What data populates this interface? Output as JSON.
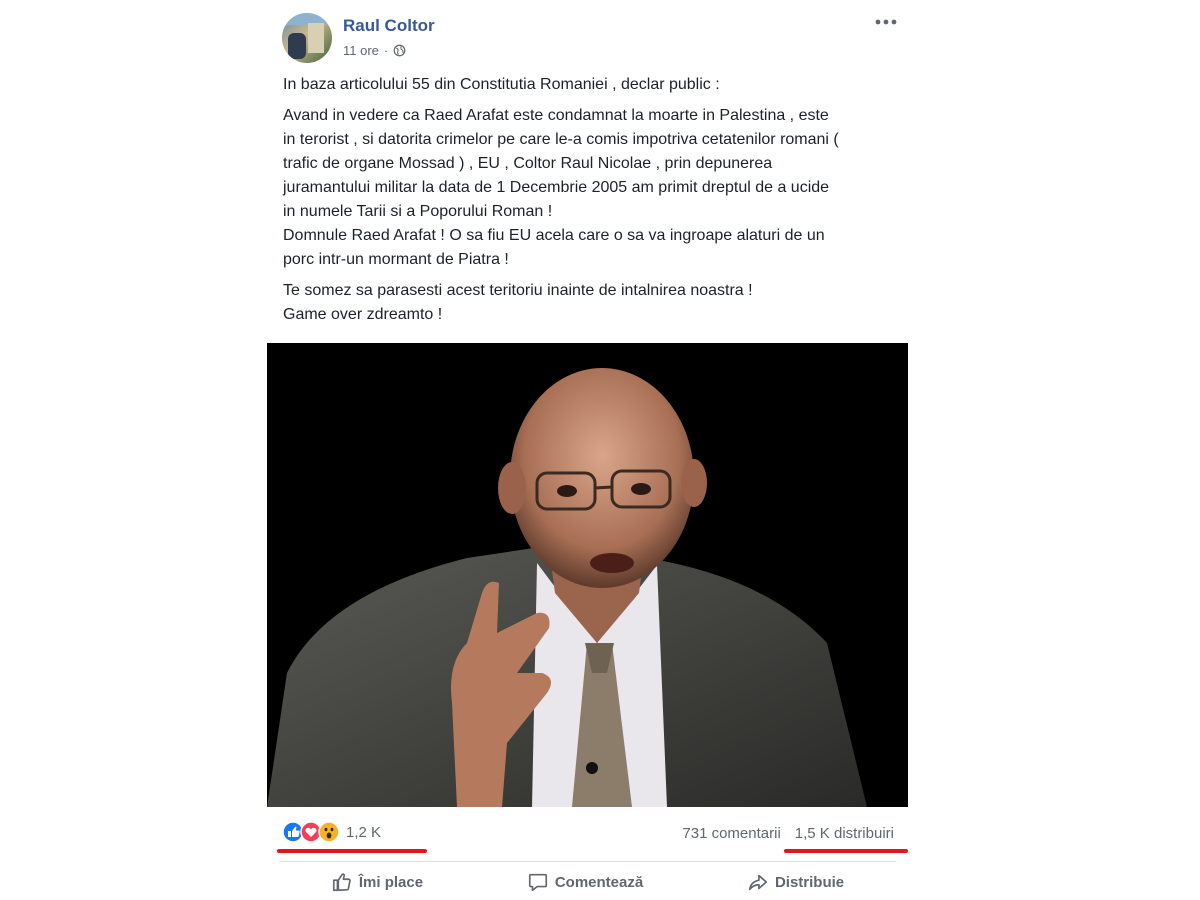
{
  "post": {
    "author": "Raul Coltor",
    "time": "11 ore",
    "privacy_icon": "globe-icon",
    "paragraphs": [
      {
        "lines": [
          "In baza articolului 55 din Constitutia Romaniei , declar public :"
        ]
      },
      {
        "lines": [
          "Avand in vedere ca Raed Arafat este condamnat la moarte in Palestina , este",
          "in terorist , si datorita crimelor pe care le-a comis impotriva cetatenilor romani (",
          "trafic de organe Mossad ) , EU , Coltor Raul Nicolae , prin depunerea",
          "juramantului militar la data de 1 Decembrie 2005 am primit dreptul de a ucide",
          "in numele Tarii si a Poporului Roman !",
          "Domnule Raed Arafat ! O sa fiu EU acela care o sa va ingroape alaturi de un",
          "porc intr-un mormant de Piatra !"
        ]
      },
      {
        "lines": [
          "Te somez sa parasesti acest teritoriu inainte de intalnirea noastra !",
          "Game over zdreamto !"
        ]
      }
    ]
  },
  "stats": {
    "reactions_count": "1,2 K",
    "comments": "731 comentarii",
    "shares": "1,5 K distribuiri",
    "reaction_icons": [
      "like-icon",
      "love-icon",
      "wow-icon"
    ],
    "highlight_color": "#e5161b"
  },
  "actions": {
    "like": "Îmi place",
    "comment": "Comentează",
    "share": "Distribuie"
  },
  "colors": {
    "author_link": "#385898",
    "muted": "#616770",
    "like_blue": "#1877f2",
    "love_red": "#f33e58",
    "wow_yellow": "#f7b125"
  }
}
